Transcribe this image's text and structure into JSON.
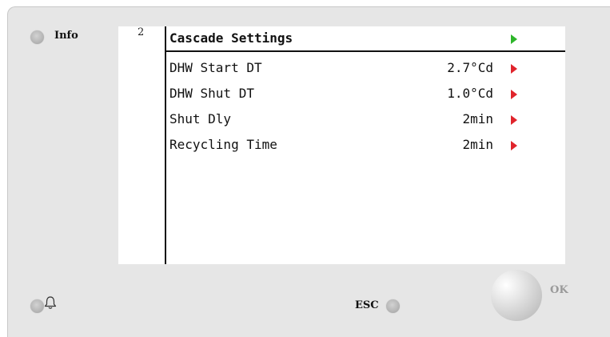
{
  "device": {
    "info_label": "Info",
    "esc_label": "ESC",
    "ok_label": "OK"
  },
  "screen": {
    "page_number": "2",
    "title": "Cascade Settings",
    "rows": [
      {
        "label": "DHW Start DT",
        "value": "2.7°Cd"
      },
      {
        "label": "DHW Shut DT",
        "value": "1.0°Cd"
      },
      {
        "label": "Shut Dly",
        "value": " 2min"
      },
      {
        "label": "Recycling Time",
        "value": " 2min"
      }
    ]
  },
  "icons": {
    "title_arrow": "green-right-triangle-icon",
    "row_arrow": "red-right-triangle-icon",
    "alarm": "bell-icon"
  },
  "colors": {
    "title_arrow": "#2db52a",
    "row_arrow": "#e0242c",
    "panel": "#e6e6e6"
  }
}
